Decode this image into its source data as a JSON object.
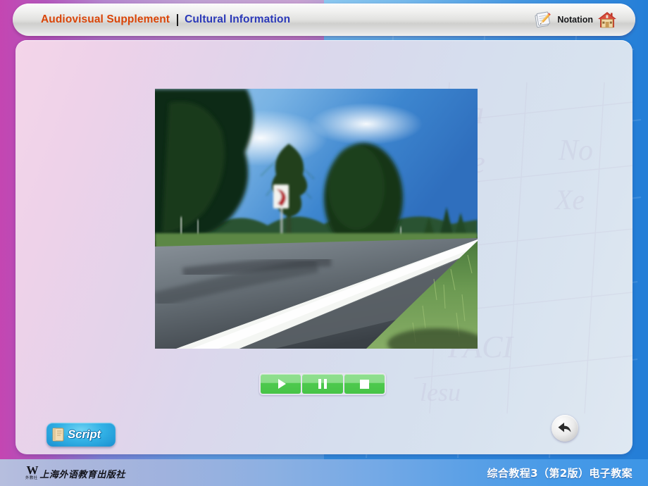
{
  "header": {
    "title_main": "Audiovisual Supplement",
    "separator": "|",
    "title_sub": "Cultural Information",
    "notation_label": "Notation",
    "notation_icon": "notepad-pencil-icon",
    "home_icon": "home-icon"
  },
  "main": {
    "video": {
      "name": "video-player",
      "scene_description": "Roadside view: asphalt road with white edge line, green grass, trees and blue sky with a red-and-white curve warning sign",
      "alt_label": "Audiovisual clip"
    },
    "media_controls": {
      "buttons": [
        {
          "name": "play-button",
          "icon": "play-icon",
          "label": "Play"
        },
        {
          "name": "pause-button",
          "icon": "pause-icon",
          "label": "Pause"
        },
        {
          "name": "stop-button",
          "icon": "stop-icon",
          "label": "Stop"
        }
      ],
      "accent_color": "#47c447"
    },
    "script_button": {
      "label": "Script",
      "icon": "book-icon",
      "accent_color": "#33b2e6"
    },
    "back_button": {
      "name": "back-button",
      "icon": "back-arrow-icon",
      "label": "Back"
    }
  },
  "footer": {
    "publisher_mark": "W",
    "publisher_mark_sub": "外教社",
    "publisher_name": "上海外语教育出版社",
    "course_title": "综合教程3（第2版）电子教案"
  },
  "colors": {
    "title_main": "#d94508",
    "title_sub": "#2a38b8",
    "panel_left": "#f4d5e9",
    "panel_right": "#dfe8f2",
    "backdrop_left": "#b34fa8",
    "backdrop_right": "#2f86d8",
    "footer_left": "#b6bede",
    "footer_right": "#3d95e6"
  }
}
